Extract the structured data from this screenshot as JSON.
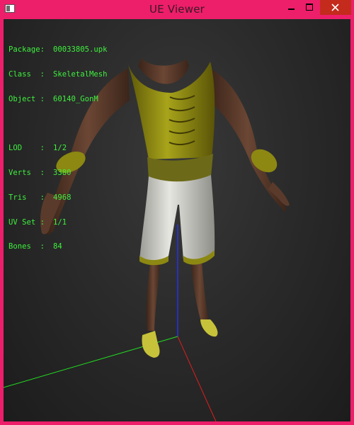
{
  "window": {
    "title": "UE Viewer"
  },
  "info_panel": {
    "package": {
      "label": "Package:",
      "value": "00033805.upk"
    },
    "class": {
      "label": "Class  :",
      "value": "SkeletalMesh"
    },
    "object": {
      "label": "Object :",
      "value": "60140_GonM"
    },
    "lod": {
      "label": "LOD    :",
      "value": "1/2"
    },
    "verts": {
      "label": "Verts  :",
      "value": "3380"
    },
    "tris": {
      "label": "Tris   :",
      "value": "4968"
    },
    "uvset": {
      "label": "UV Set :",
      "value": "1/1"
    },
    "bones": {
      "label": "Bones  :",
      "value": "84"
    }
  },
  "colors": {
    "info_text": "#3ef03e",
    "border": "#ed1e6a",
    "close_button": "#c42b1c",
    "axis_x": "#e01e1e",
    "axis_y": "#22dd22",
    "axis_z": "#2233ee"
  }
}
